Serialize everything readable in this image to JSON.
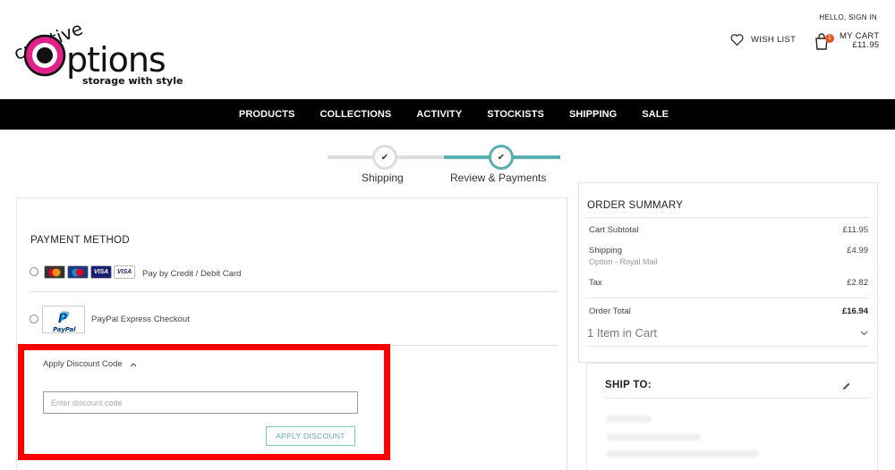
{
  "brand": {
    "logo_top": "creative",
    "logo_main": "Options",
    "tagline": "storage with style"
  },
  "header": {
    "hello": "HELLO, SIGN IN",
    "wishlist": "WISH LIST",
    "cart_label": "MY CART",
    "cart_total": "£11.95",
    "cart_count": "1"
  },
  "nav": {
    "items": [
      "PRODUCTS",
      "COLLECTIONS",
      "ACTIVITY",
      "STOCKISTS",
      "SHIPPING",
      "SALE"
    ]
  },
  "stepper": {
    "step1": "Shipping",
    "step2": "Review & Payments",
    "check": "✔"
  },
  "payment": {
    "title": "PAYMENT METHOD",
    "card_option": "Pay by Credit / Debit Card",
    "card_icons": [
      "VISA",
      "VISA"
    ],
    "paypal_option": "PayPal Express Checkout",
    "paypal_logo": "PayPal"
  },
  "discount": {
    "toggle": "Apply Discount Code",
    "placeholder": "Enter discount code",
    "button": "APPLY DISCOUNT"
  },
  "summary": {
    "title": "ORDER SUMMARY",
    "subtotal_label": "Cart Subtotal",
    "subtotal": "£11.95",
    "shipping_label": "Shipping",
    "shipping_method": "Option - Royal Mail",
    "shipping": "£4.99",
    "tax_label": "Tax",
    "tax": "£2.82",
    "total_label": "Order Total",
    "total": "£16.94",
    "items": "1 Item in Cart"
  },
  "shipto": {
    "title": "SHIP TO:"
  },
  "colors": {
    "accent": "#5aaead",
    "highlight": "#ff0000",
    "badge": "#e8531e"
  }
}
